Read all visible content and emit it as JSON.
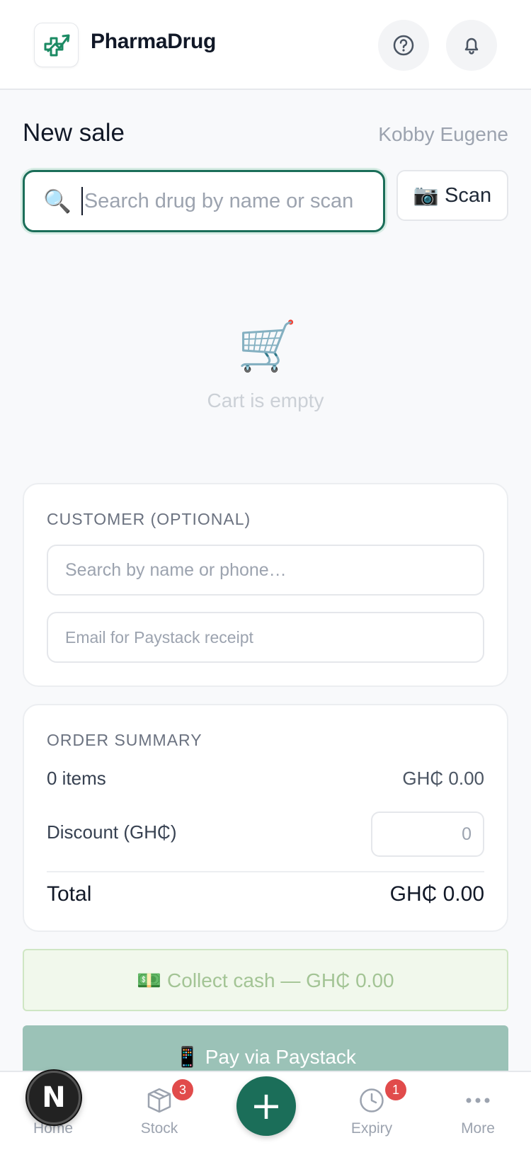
{
  "header": {
    "brand": "PharmaDrug",
    "help_icon": "help-circle-icon",
    "bell_icon": "bell-icon",
    "accent": "#1b6e59"
  },
  "sale": {
    "title": "New sale",
    "user": "Kobby Eugene"
  },
  "search": {
    "placeholder": "Search drug by name or scan",
    "value": "",
    "scan_label": "📷 Scan"
  },
  "cart": {
    "empty_text": "Cart is empty"
  },
  "customer": {
    "heading": "CUSTOMER (OPTIONAL)",
    "name_placeholder": "Search by name or phone…",
    "email_placeholder": "Email for Paystack receipt"
  },
  "summary": {
    "heading": "ORDER SUMMARY",
    "items_label": "0 items",
    "items_value": "GH₵ 0.00",
    "discount_label": "Discount (GH₵)",
    "discount_placeholder": "0",
    "total_label": "Total",
    "total_value": "GH₵ 0.00"
  },
  "actions": {
    "cash_label": "💵 Collect cash — GH₵ 0.00",
    "paystack_label": "📱 Pay via Paystack"
  },
  "nav": {
    "home": "Home",
    "stock": "Stock",
    "stock_badge": "3",
    "add": "+",
    "expiry": "Expiry",
    "expiry_badge": "1",
    "more": "More",
    "avatar_letter": "N"
  }
}
